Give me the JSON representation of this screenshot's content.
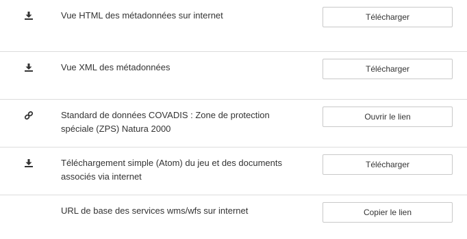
{
  "resources": [
    {
      "icon": "download-icon",
      "label": "Vue HTML des métadonnées sur internet",
      "action": "Télécharger"
    },
    {
      "icon": "download-icon",
      "label": "Vue XML des métadonnées",
      "action": "Télécharger"
    },
    {
      "icon": "link-icon",
      "label": "Standard de données COVADIS : Zone de protection spéciale (ZPS) Natura 2000",
      "action": "Ouvrir le lien"
    },
    {
      "icon": "download-icon",
      "label": "Téléchargement simple (Atom) du jeu et des documents associés via internet",
      "action": "Télécharger"
    },
    {
      "icon": "",
      "label": "URL de base des services wms/wfs sur internet",
      "action": "Copier le lien"
    }
  ]
}
